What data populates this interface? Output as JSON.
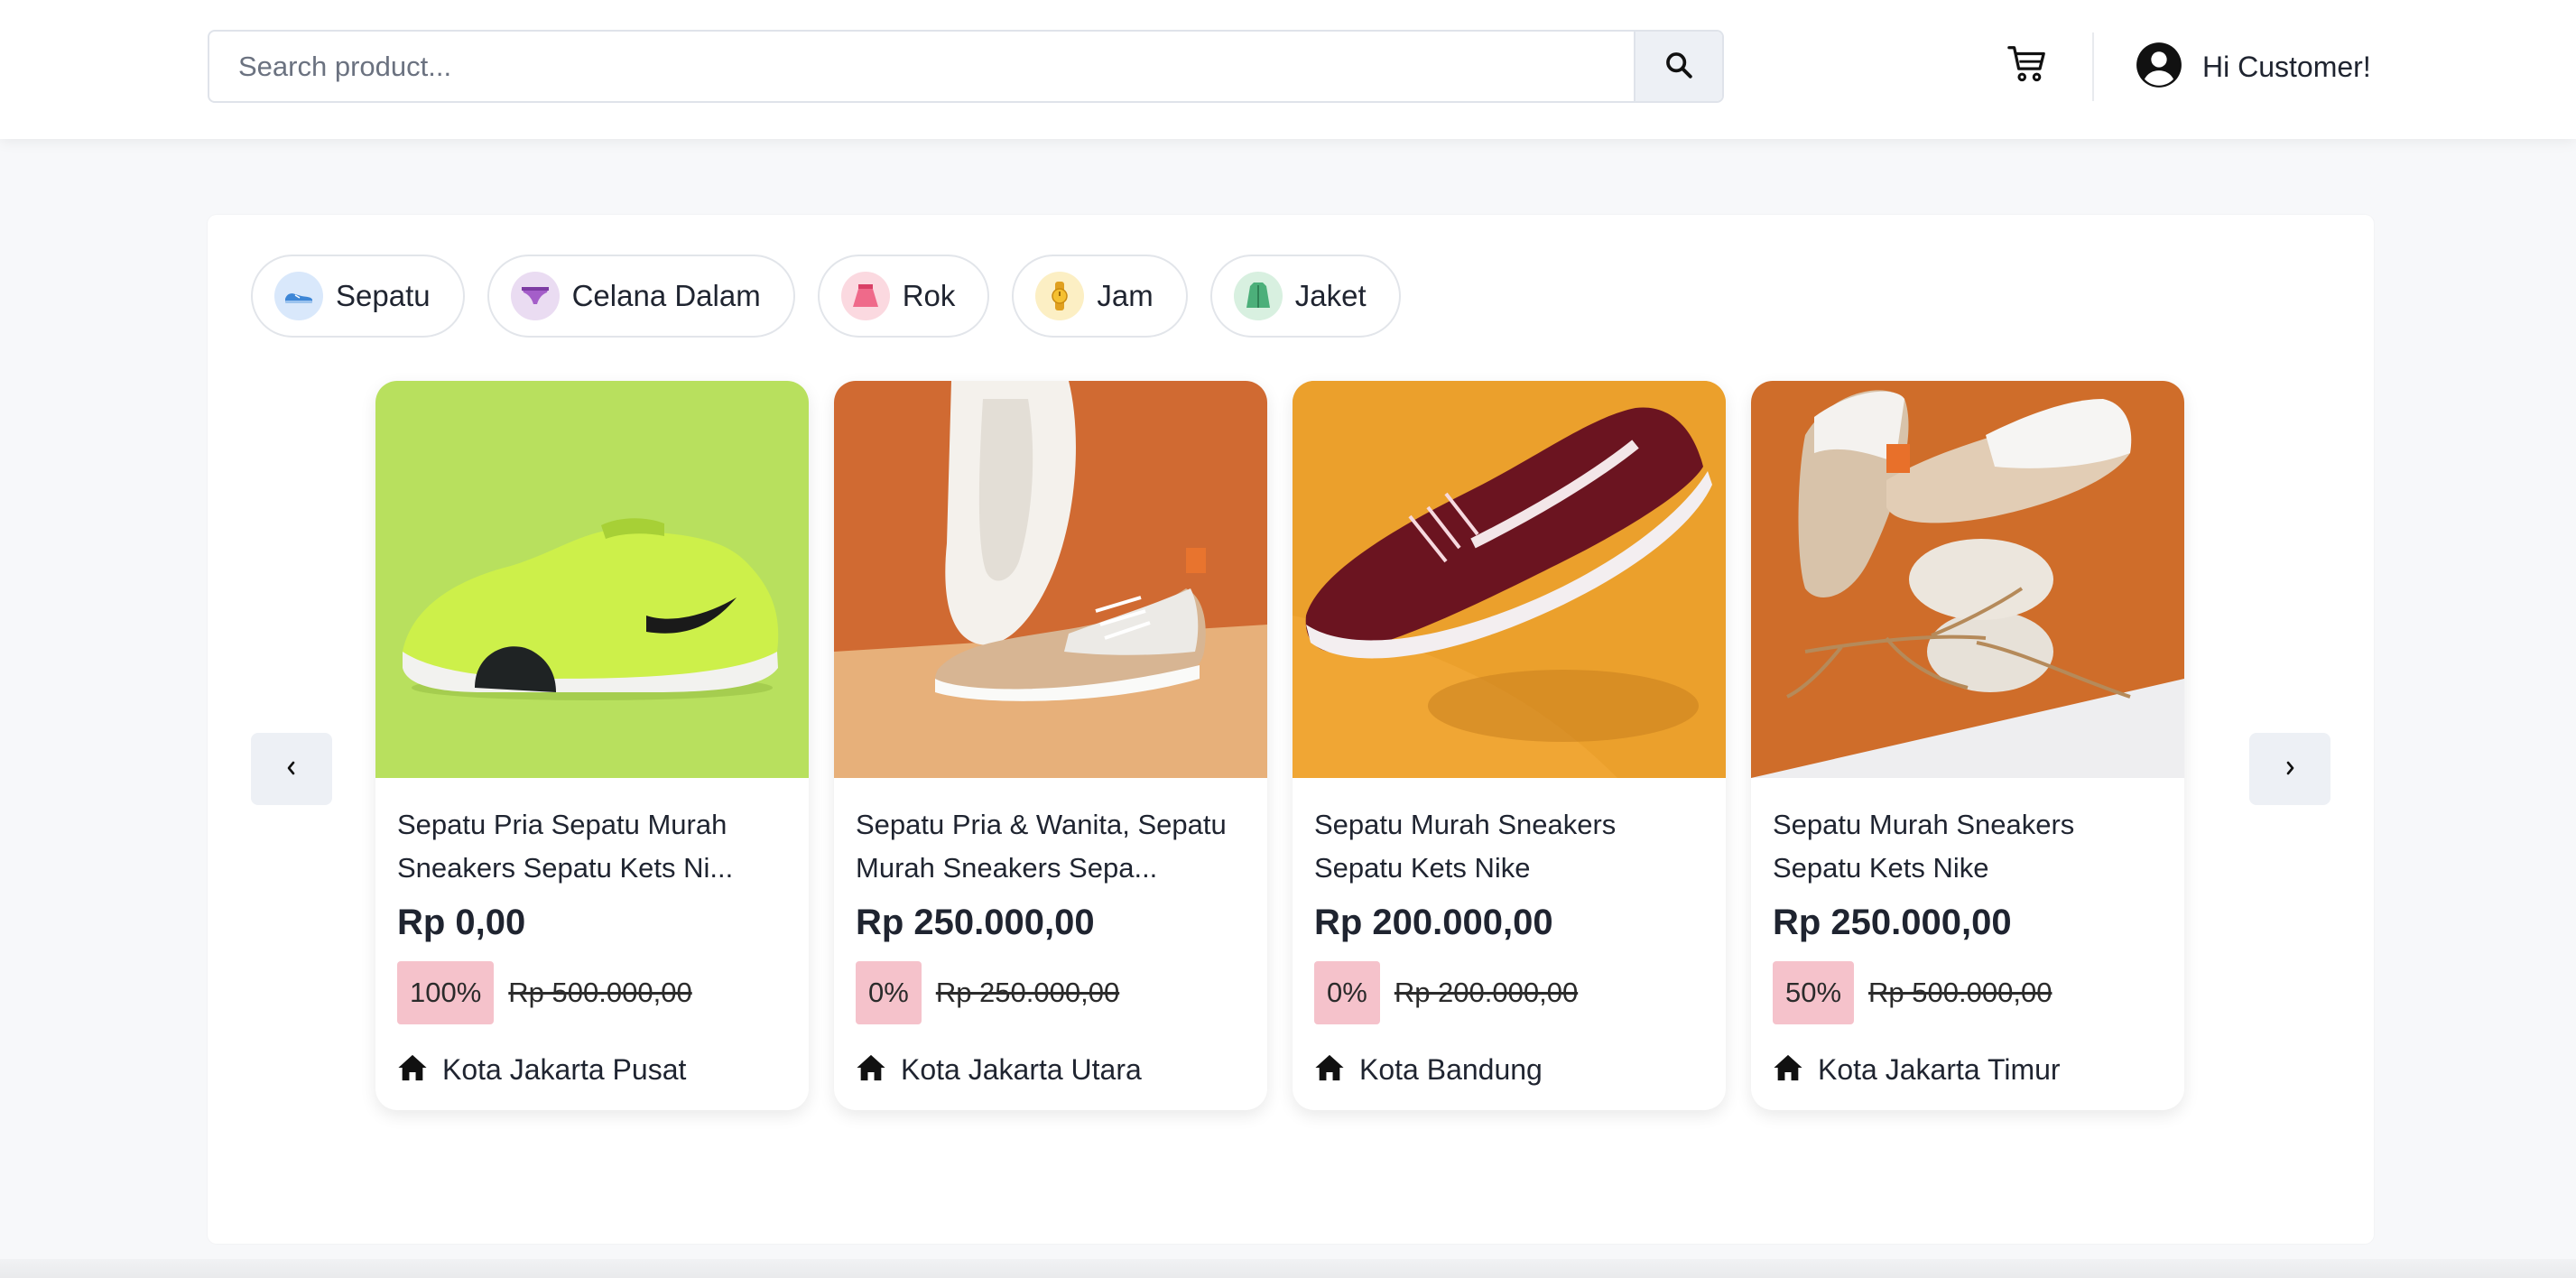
{
  "header": {
    "search_placeholder": "Search product...",
    "search_icon": "search-icon",
    "cart_icon": "cart-icon",
    "user_icon": "user-circle-icon",
    "greeting": "Hi Customer!"
  },
  "categories": [
    {
      "label": "Sepatu",
      "icon": "shoe-icon",
      "color": "#d9e8fb"
    },
    {
      "label": "Celana Dalam",
      "icon": "underwear-icon",
      "color": "#eadcf2"
    },
    {
      "label": "Rok",
      "icon": "skirt-icon",
      "color": "#fbd9e0"
    },
    {
      "label": "Jam",
      "icon": "watch-icon",
      "color": "#fcefc4"
    },
    {
      "label": "Jaket",
      "icon": "jacket-icon",
      "color": "#d8f0e0"
    }
  ],
  "carousel": {
    "prev_label": "‹",
    "next_label": "›"
  },
  "products": [
    {
      "title": "Sepatu Pria Sepatu Murah Sneakers Sepatu Kets Ni...",
      "price": "Rp 0,00",
      "discount": "100%",
      "old_price": "Rp 500.000,00",
      "location": "Kota Jakarta Pusat",
      "image_bg": "#b8e05e"
    },
    {
      "title": "Sepatu Pria & Wanita, Sepatu Murah Sneakers Sepa...",
      "price": "Rp 250.000,00",
      "discount": "0%",
      "old_price": "Rp 250.000,00",
      "location": "Kota Jakarta Utara",
      "image_bg": "#d06a32"
    },
    {
      "title": "Sepatu Murah Sneakers Sepatu Kets Nike",
      "price": "Rp 200.000,00",
      "discount": "0%",
      "old_price": "Rp 200.000,00",
      "location": "Kota Bandung",
      "image_bg": "#f0a634"
    },
    {
      "title": "Sepatu Murah Sneakers Sepatu Kets Nike",
      "price": "Rp 250.000,00",
      "discount": "50%",
      "old_price": "Rp 500.000,00",
      "location": "Kota Jakarta Timur",
      "image_bg": "#cf6d2a"
    }
  ],
  "colors": {
    "badge_bg": "#f5c2cb",
    "button_bg": "#edf0f5",
    "text": "#1f2430"
  }
}
